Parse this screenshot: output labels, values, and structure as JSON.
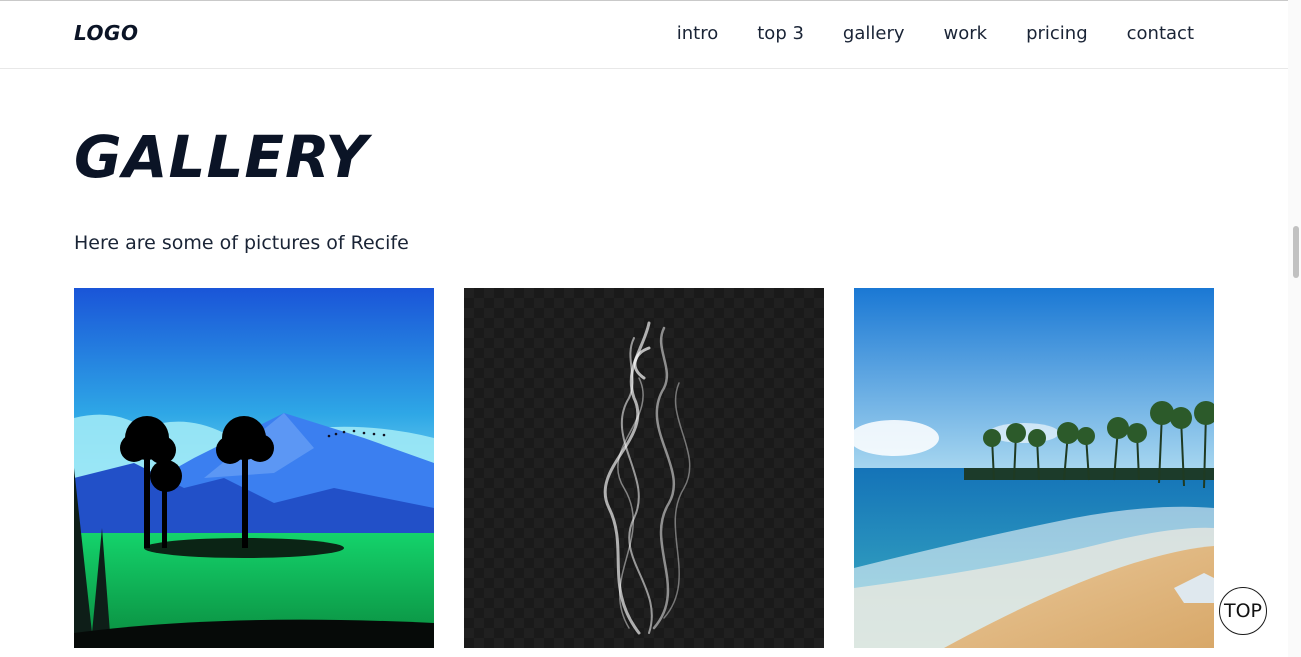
{
  "header": {
    "logo": "LOGO",
    "nav": [
      "intro",
      "top 3",
      "gallery",
      "work",
      "pricing",
      "contact"
    ]
  },
  "section": {
    "title": "GALLERY",
    "subtitle": "Here are some of pictures of Recife"
  },
  "gallery": {
    "images": [
      "mountain-palms-illustration",
      "white-smoke",
      "beach-palms-photo"
    ]
  },
  "top_button": {
    "label": "TOP"
  },
  "colors": {
    "heading": "#0b1426",
    "text": "#1a2436"
  }
}
